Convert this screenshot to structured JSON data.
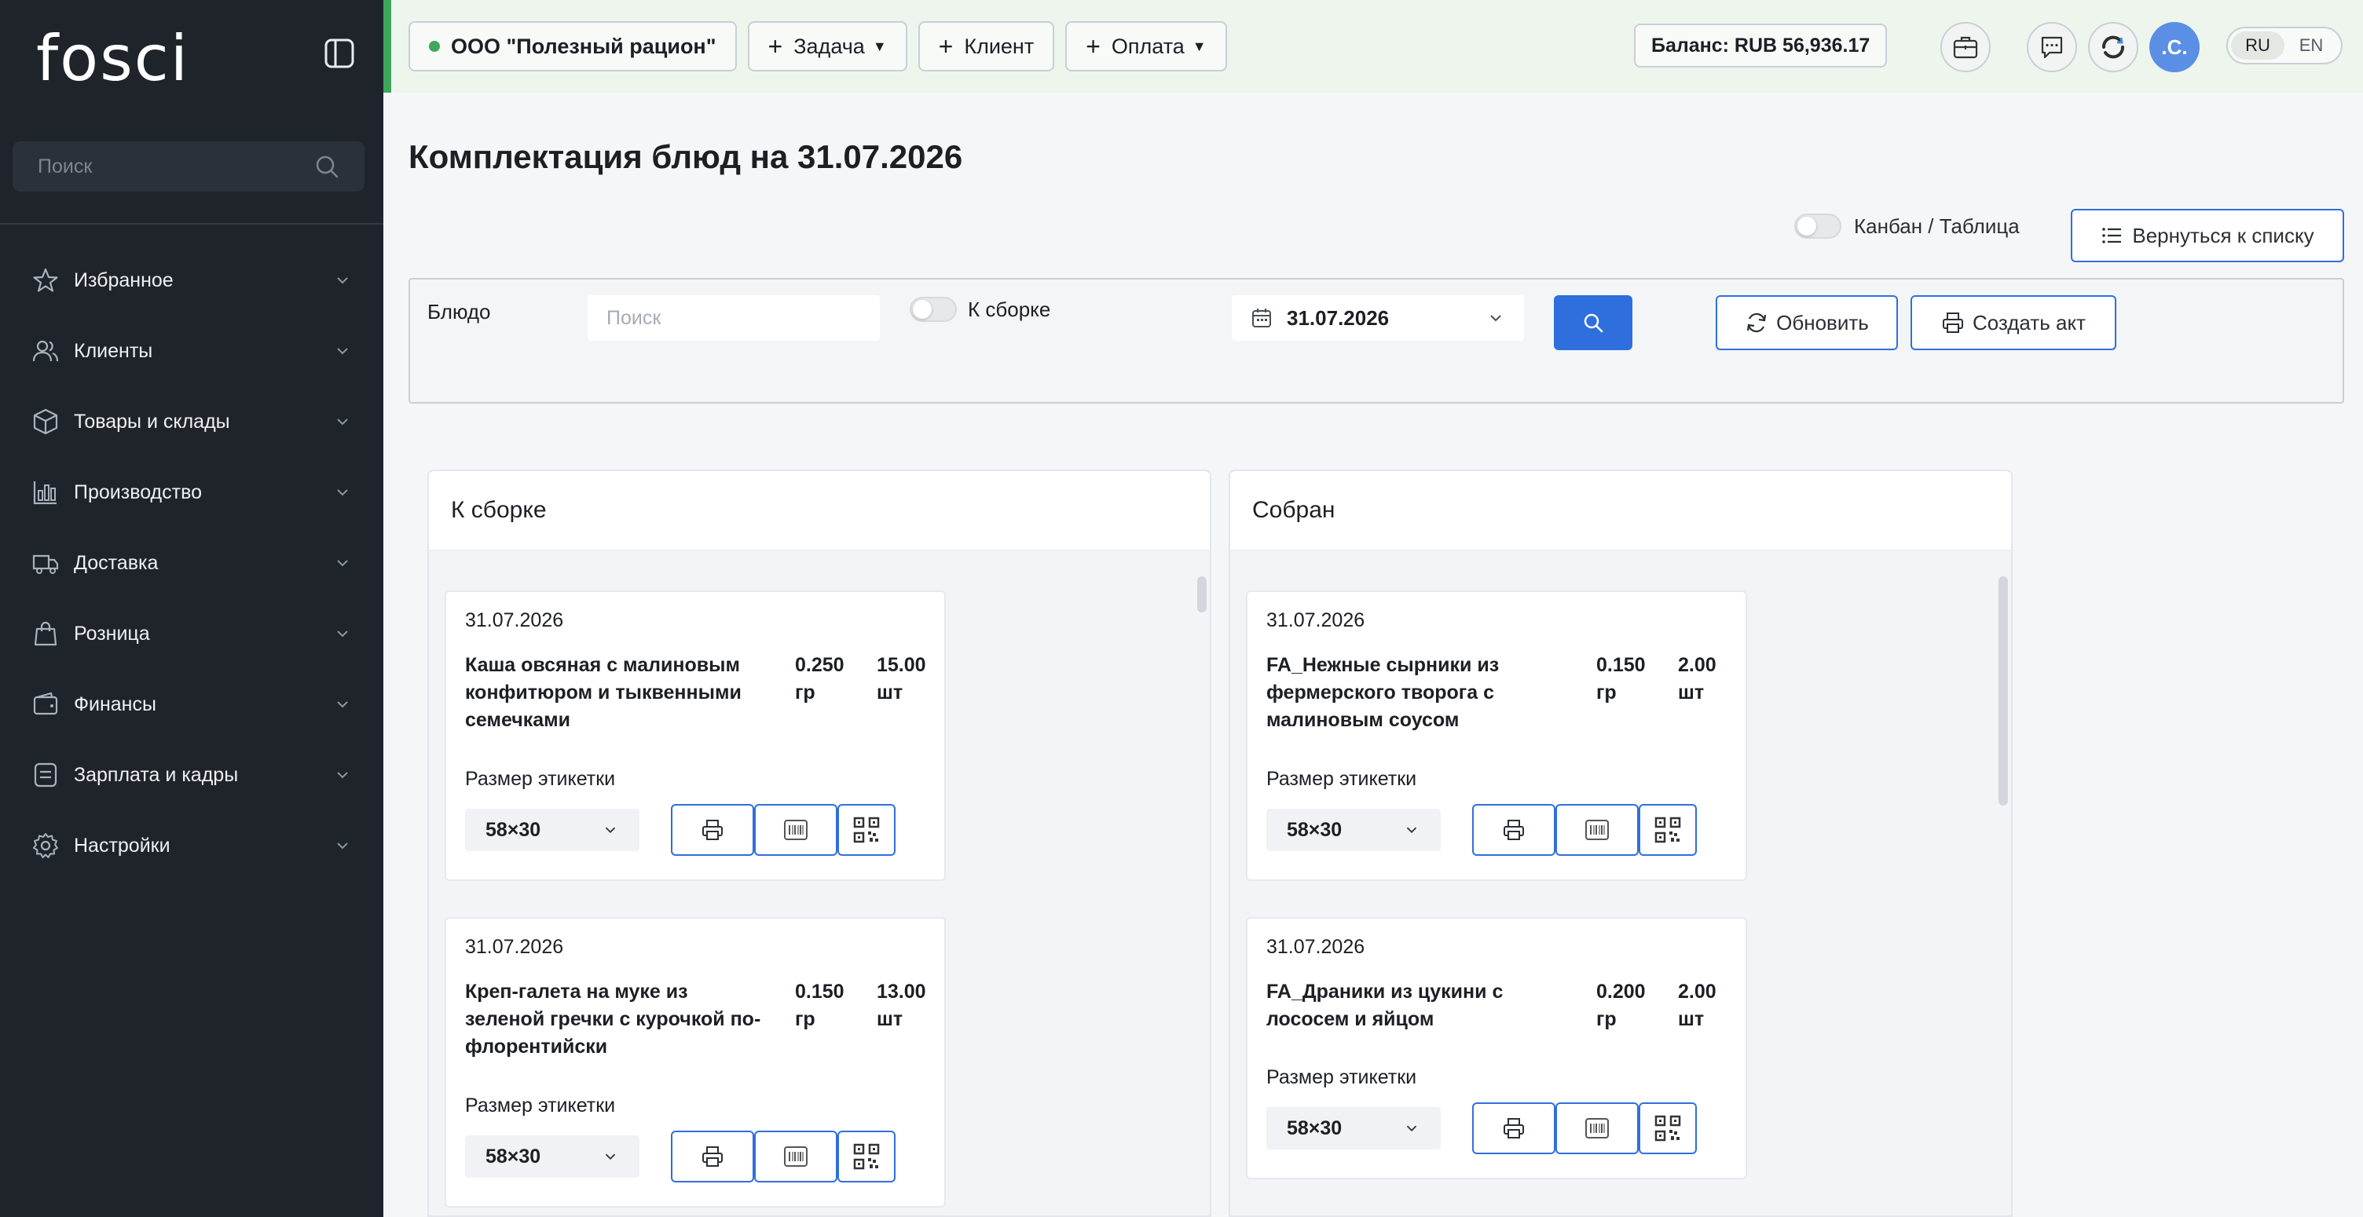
{
  "sidebar": {
    "logo": "fosci",
    "search_placeholder": "Поиск",
    "items": [
      {
        "label": "Избранное",
        "icon": "star-icon"
      },
      {
        "label": "Клиенты",
        "icon": "users-icon"
      },
      {
        "label": "Товары и склады",
        "icon": "box-icon"
      },
      {
        "label": "Производство",
        "icon": "chart-icon"
      },
      {
        "label": "Доставка",
        "icon": "truck-icon"
      },
      {
        "label": "Розница",
        "icon": "shopping-bag-icon"
      },
      {
        "label": "Финансы",
        "icon": "wallet-icon"
      },
      {
        "label": "Зарплата и кадры",
        "icon": "document-icon"
      },
      {
        "label": "Настройки",
        "icon": "gear-icon"
      }
    ]
  },
  "topbar": {
    "organization": "ООО \"Полезный рацион\"",
    "task_label": "Задача",
    "client_label": "Клиент",
    "payment_label": "Оплата",
    "balance": "Баланс: RUB 56,936.17",
    "avatar": ".C.",
    "lang_ru": "RU",
    "lang_en": "EN",
    "accent_color": "#3ea85a"
  },
  "main": {
    "title": "Комплектация блюд на 31.07.2026",
    "view_toggle_label": "Канбан / Таблица",
    "back_label": "Вернуться к списку"
  },
  "filter": {
    "dish_label": "Блюдо",
    "search_placeholder": "Поиск",
    "assembly_label": "К сборке",
    "date": "31.07.2026",
    "refresh_label": "Обновить",
    "create_act_label": "Создать акт"
  },
  "columns": [
    {
      "title": "К сборке",
      "cards": [
        {
          "date": "31.07.2026",
          "name": "Каша овсяная с малиновым конфитюром и тыквенными семечками",
          "weight": "0.250 гр",
          "qty": "15.00 шт",
          "size_label": "Размер этикетки",
          "size": "58×30"
        },
        {
          "date": "31.07.2026",
          "name": "Креп-галета на муке из зеленой гречки с курочкой по-флорентийски",
          "weight": "0.150 гр",
          "qty": "13.00 шт",
          "size_label": "Размер этикетки",
          "size": "58×30"
        }
      ]
    },
    {
      "title": "Собран",
      "cards": [
        {
          "date": "31.07.2026",
          "name": "FA_Нежные сырники из фермерского творога с малиновым соусом",
          "weight": "0.150 гр",
          "qty": "2.00 шт",
          "size_label": "Размер этикетки",
          "size": "58×30"
        },
        {
          "date": "31.07.2026",
          "name": "FA_Драники из цукини с лососем и яйцом",
          "weight": "0.200 гр",
          "qty": "2.00 шт",
          "size_label": "Размер этикетки",
          "size": "58×30"
        }
      ]
    }
  ]
}
